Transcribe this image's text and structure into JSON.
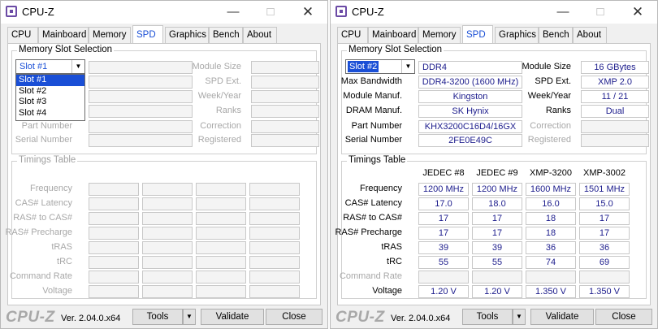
{
  "windows": [
    {
      "id": "left",
      "title": "CPU-Z",
      "tabs": [
        "CPU",
        "Mainboard",
        "Memory",
        "SPD",
        "Graphics",
        "Bench",
        "About"
      ],
      "active_tab": "SPD",
      "memory_slot_selection": {
        "title": "Memory Slot Selection",
        "selected_slot": "Slot #1",
        "dropdown_open": true,
        "dropdown_options": [
          "Slot #1",
          "Slot #2",
          "Slot #3",
          "Slot #4"
        ],
        "dropdown_selected": "Slot #1",
        "module_type": "",
        "left_labels": {
          "max_bandwidth": "",
          "module_manuf": "",
          "dram_manuf": "",
          "part_number": "Part Number",
          "serial_number": "Serial Number"
        },
        "left_values": {
          "max_bandwidth": "",
          "module_manuf": "",
          "dram_manuf": "",
          "part_number": "",
          "serial_number": ""
        },
        "right_labels": {
          "module_size": "Module Size",
          "spd_ext": "SPD Ext.",
          "week_year": "Week/Year",
          "ranks": "Ranks",
          "correction": "Correction",
          "registered": "Registered"
        },
        "right_values": {
          "module_size": "",
          "spd_ext": "",
          "week_year": "",
          "ranks": "",
          "correction": "",
          "registered": ""
        }
      },
      "timings_table": {
        "title": "Timings Table",
        "columns": [
          "",
          "",
          "",
          ""
        ],
        "rows": [
          {
            "label": "Frequency",
            "values": [
              "",
              "",
              "",
              ""
            ]
          },
          {
            "label": "CAS# Latency",
            "values": [
              "",
              "",
              "",
              ""
            ]
          },
          {
            "label": "RAS# to CAS#",
            "values": [
              "",
              "",
              "",
              ""
            ]
          },
          {
            "label": "RAS# Precharge",
            "values": [
              "",
              "",
              "",
              ""
            ]
          },
          {
            "label": "tRAS",
            "values": [
              "",
              "",
              "",
              ""
            ]
          },
          {
            "label": "tRC",
            "values": [
              "",
              "",
              "",
              ""
            ]
          },
          {
            "label": "Command Rate",
            "values": [
              "",
              "",
              "",
              ""
            ]
          },
          {
            "label": "Voltage",
            "values": [
              "",
              "",
              "",
              ""
            ]
          }
        ]
      },
      "footer": {
        "logo": "CPU-Z",
        "version": "Ver. 2.04.0.x64",
        "tools": "Tools",
        "validate": "Validate",
        "close": "Close"
      }
    },
    {
      "id": "right",
      "title": "CPU-Z",
      "tabs": [
        "CPU",
        "Mainboard",
        "Memory",
        "SPD",
        "Graphics",
        "Bench",
        "About"
      ],
      "active_tab": "SPD",
      "memory_slot_selection": {
        "title": "Memory Slot Selection",
        "selected_slot": "Slot #2",
        "dropdown_open": false,
        "dropdown_options": [],
        "dropdown_selected": "",
        "module_type": "DDR4",
        "left_labels": {
          "max_bandwidth": "Max Bandwidth",
          "module_manuf": "Module Manuf.",
          "dram_manuf": "DRAM Manuf.",
          "part_number": "Part Number",
          "serial_number": "Serial Number"
        },
        "left_values": {
          "max_bandwidth": "DDR4-3200 (1600 MHz)",
          "module_manuf": "Kingston",
          "dram_manuf": "SK Hynix",
          "part_number": "KHX3200C16D4/16GX",
          "serial_number": "2FE0E49C"
        },
        "right_labels": {
          "module_size": "Module Size",
          "spd_ext": "SPD Ext.",
          "week_year": "Week/Year",
          "ranks": "Ranks",
          "correction": "Correction",
          "registered": "Registered"
        },
        "right_values": {
          "module_size": "16 GBytes",
          "spd_ext": "XMP 2.0",
          "week_year": "11 / 21",
          "ranks": "Dual",
          "correction": "",
          "registered": ""
        }
      },
      "timings_table": {
        "title": "Timings Table",
        "columns": [
          "JEDEC #8",
          "JEDEC #9",
          "XMP-3200",
          "XMP-3002"
        ],
        "rows": [
          {
            "label": "Frequency",
            "values": [
              "1200 MHz",
              "1200 MHz",
              "1600 MHz",
              "1501 MHz"
            ]
          },
          {
            "label": "CAS# Latency",
            "values": [
              "17.0",
              "18.0",
              "16.0",
              "15.0"
            ]
          },
          {
            "label": "RAS# to CAS#",
            "values": [
              "17",
              "17",
              "18",
              "17"
            ]
          },
          {
            "label": "RAS# Precharge",
            "values": [
              "17",
              "17",
              "18",
              "17"
            ]
          },
          {
            "label": "tRAS",
            "values": [
              "39",
              "39",
              "36",
              "36"
            ]
          },
          {
            "label": "tRC",
            "values": [
              "55",
              "55",
              "74",
              "69"
            ]
          },
          {
            "label": "Command Rate",
            "values": [
              "",
              "",
              "",
              ""
            ]
          },
          {
            "label": "Voltage",
            "values": [
              "1.20 V",
              "1.20 V",
              "1.350 V",
              "1.350 V"
            ]
          }
        ]
      },
      "footer": {
        "logo": "CPU-Z",
        "version": "Ver. 2.04.0.x64",
        "tools": "Tools",
        "validate": "Validate",
        "close": "Close"
      }
    }
  ]
}
